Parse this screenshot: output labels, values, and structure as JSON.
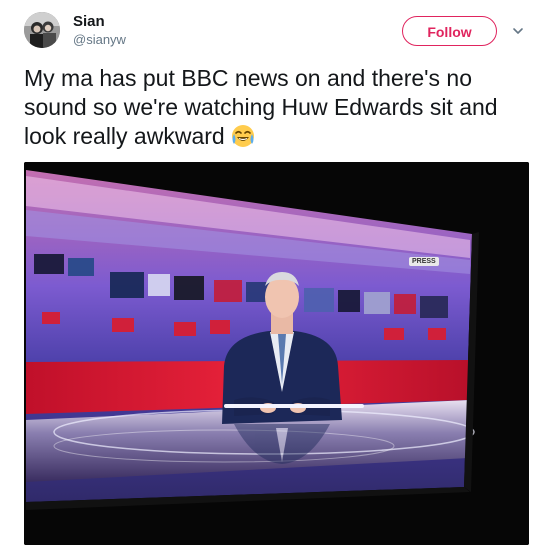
{
  "tweet": {
    "display_name": "Sian",
    "handle": "@sianyw",
    "follow_label": "Follow",
    "text": "My ma has put BBC news on and there's no sound so we're watching Huw Edwards sit and look really awkward",
    "emoji": "face-with-tears-of-joy"
  },
  "media": {
    "screen_sign": "PRESS"
  },
  "colors": {
    "follow_accent": "#e0245e",
    "text_primary": "#14171a",
    "text_secondary": "#657786"
  }
}
